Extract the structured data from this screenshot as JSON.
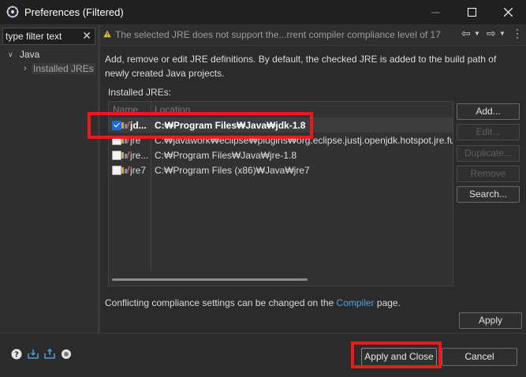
{
  "window": {
    "title": "Preferences (Filtered)",
    "minimize_icon": "minimize-icon",
    "maximize_icon": "maximize-icon",
    "close_icon": "close-icon"
  },
  "sidebar": {
    "filter_placeholder": "type filter text",
    "tree": [
      {
        "label": "Java",
        "expanded": true
      },
      {
        "label": "Installed JREs",
        "selected": true
      }
    ]
  },
  "message": {
    "text": "The selected JRE does not support the...rrent compiler compliance level of 17",
    "icon": "warning-icon"
  },
  "page": {
    "description": "Add, remove or edit JRE definitions. By default, the checked JRE is added to the build path of newly created Java projects.",
    "installed_label": "Installed JREs:",
    "columns": {
      "name": "Name",
      "location": "Location"
    },
    "jres": [
      {
        "name": "jd...",
        "location": "C:₩Program Files₩Java₩jdk-1.8",
        "checked": true,
        "selected": true
      },
      {
        "name": "jre",
        "location": "C:₩javawork₩eclipse₩plugins₩org.eclipse.justj.openjdk.hotspot.jre.full",
        "checked": false,
        "selected": false
      },
      {
        "name": "jre...",
        "location": "C:₩Program Files₩Java₩jre-1.8",
        "checked": false,
        "selected": false
      },
      {
        "name": "jre7",
        "location": "C:₩Program Files (x86)₩Java₩jre7",
        "checked": false,
        "selected": false
      }
    ],
    "buttons": {
      "add": "Add...",
      "edit": "Edit...",
      "duplicate": "Duplicate...",
      "remove": "Remove",
      "search": "Search..."
    },
    "conflict_prefix": "Conflicting compliance settings can be changed on the",
    "conflict_link": "Compiler",
    "conflict_suffix": "page.",
    "apply": "Apply"
  },
  "footer": {
    "apply_close": "Apply and Close",
    "cancel": "Cancel"
  },
  "colors": {
    "highlight": "#e81a1a",
    "link": "#4aa3df",
    "checkbox": "#1e6bd6"
  }
}
